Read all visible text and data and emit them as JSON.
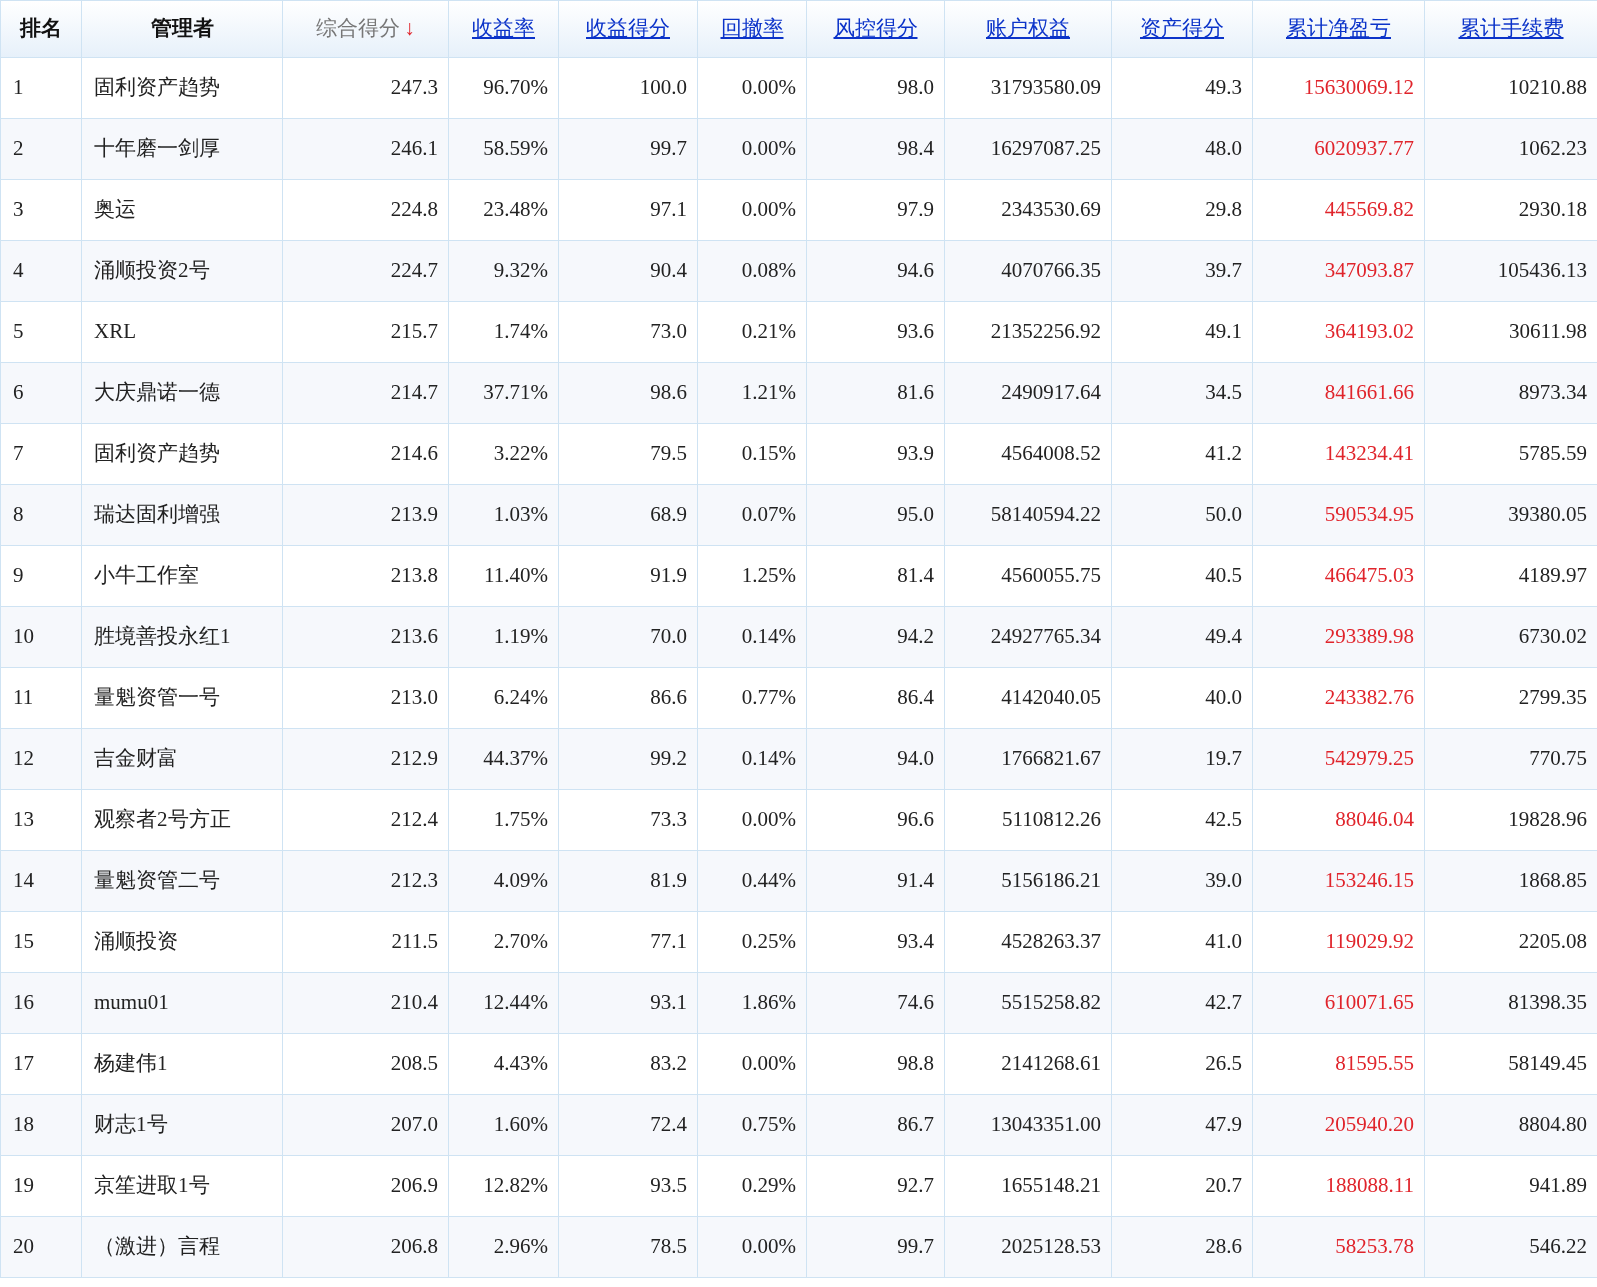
{
  "table": {
    "columns": [
      {
        "label": "排名",
        "kind": "plain"
      },
      {
        "label": "管理者",
        "kind": "plain"
      },
      {
        "label": "综合得分",
        "kind": "sorted",
        "sort_arrow": "↓"
      },
      {
        "label": "收益率",
        "kind": "link"
      },
      {
        "label": "收益得分",
        "kind": "link"
      },
      {
        "label": "回撤率",
        "kind": "link"
      },
      {
        "label": "风控得分",
        "kind": "link"
      },
      {
        "label": "账户权益",
        "kind": "link"
      },
      {
        "label": "资产得分",
        "kind": "link"
      },
      {
        "label": "累计净盈亏",
        "kind": "link",
        "color": "#e0242b"
      },
      {
        "label": "累计手续费",
        "kind": "link"
      }
    ],
    "rows": [
      [
        "1",
        "固利资产趋势",
        "247.3",
        "96.70%",
        "100.0",
        "0.00%",
        "98.0",
        "31793580.09",
        "49.3",
        "15630069.12",
        "10210.88"
      ],
      [
        "2",
        "十年磨一剑厚",
        "246.1",
        "58.59%",
        "99.7",
        "0.00%",
        "98.4",
        "16297087.25",
        "48.0",
        "6020937.77",
        "1062.23"
      ],
      [
        "3",
        "奥运",
        "224.8",
        "23.48%",
        "97.1",
        "0.00%",
        "97.9",
        "2343530.69",
        "29.8",
        "445569.82",
        "2930.18"
      ],
      [
        "4",
        "涌顺投资2号",
        "224.7",
        "9.32%",
        "90.4",
        "0.08%",
        "94.6",
        "4070766.35",
        "39.7",
        "347093.87",
        "105436.13"
      ],
      [
        "5",
        "XRL",
        "215.7",
        "1.74%",
        "73.0",
        "0.21%",
        "93.6",
        "21352256.92",
        "49.1",
        "364193.02",
        "30611.98"
      ],
      [
        "6",
        "大庆鼎诺一德",
        "214.7",
        "37.71%",
        "98.6",
        "1.21%",
        "81.6",
        "2490917.64",
        "34.5",
        "841661.66",
        "8973.34"
      ],
      [
        "7",
        "固利资产趋势",
        "214.6",
        "3.22%",
        "79.5",
        "0.15%",
        "93.9",
        "4564008.52",
        "41.2",
        "143234.41",
        "5785.59"
      ],
      [
        "8",
        "瑞达固利增强",
        "213.9",
        "1.03%",
        "68.9",
        "0.07%",
        "95.0",
        "58140594.22",
        "50.0",
        "590534.95",
        "39380.05"
      ],
      [
        "9",
        "小牛工作室",
        "213.8",
        "11.40%",
        "91.9",
        "1.25%",
        "81.4",
        "4560055.75",
        "40.5",
        "466475.03",
        "4189.97"
      ],
      [
        "10",
        "胜境善投永红1",
        "213.6",
        "1.19%",
        "70.0",
        "0.14%",
        "94.2",
        "24927765.34",
        "49.4",
        "293389.98",
        "6730.02"
      ],
      [
        "11",
        "量魁资管一号",
        "213.0",
        "6.24%",
        "86.6",
        "0.77%",
        "86.4",
        "4142040.05",
        "40.0",
        "243382.76",
        "2799.35"
      ],
      [
        "12",
        "吉金财富",
        "212.9",
        "44.37%",
        "99.2",
        "0.14%",
        "94.0",
        "1766821.67",
        "19.7",
        "542979.25",
        "770.75"
      ],
      [
        "13",
        "观察者2号方正",
        "212.4",
        "1.75%",
        "73.3",
        "0.00%",
        "96.6",
        "5110812.26",
        "42.5",
        "88046.04",
        "19828.96"
      ],
      [
        "14",
        "量魁资管二号",
        "212.3",
        "4.09%",
        "81.9",
        "0.44%",
        "91.4",
        "5156186.21",
        "39.0",
        "153246.15",
        "1868.85"
      ],
      [
        "15",
        "涌顺投资",
        "211.5",
        "2.70%",
        "77.1",
        "0.25%",
        "93.4",
        "4528263.37",
        "41.0",
        "119029.92",
        "2205.08"
      ],
      [
        "16",
        "mumu01",
        "210.4",
        "12.44%",
        "93.1",
        "1.86%",
        "74.6",
        "5515258.82",
        "42.7",
        "610071.65",
        "81398.35"
      ],
      [
        "17",
        "杨建伟1",
        "208.5",
        "4.43%",
        "83.2",
        "0.00%",
        "98.8",
        "2141268.61",
        "26.5",
        "81595.55",
        "58149.45"
      ],
      [
        "18",
        "财志1号",
        "207.0",
        "1.60%",
        "72.4",
        "0.75%",
        "86.7",
        "13043351.00",
        "47.9",
        "205940.20",
        "8804.80"
      ],
      [
        "19",
        "京笙进取1号",
        "206.9",
        "12.82%",
        "93.5",
        "0.29%",
        "92.7",
        "1655148.21",
        "20.7",
        "188088.11",
        "941.89"
      ],
      [
        "20",
        "（激进）言程",
        "206.8",
        "2.96%",
        "78.5",
        "0.00%",
        "99.7",
        "2025128.53",
        "28.6",
        "58253.78",
        "546.22"
      ]
    ]
  }
}
